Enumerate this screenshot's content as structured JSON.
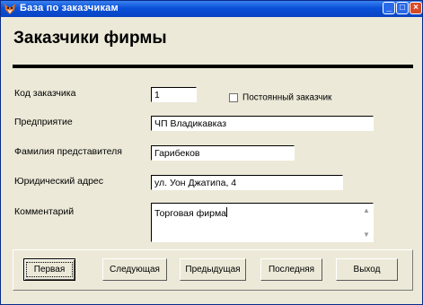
{
  "window": {
    "title": "База по заказчикам",
    "app_icon": "fox-icon",
    "controls": {
      "minimize": "_",
      "maximize": "□",
      "close": "×"
    }
  },
  "form": {
    "heading": "Заказчики фирмы",
    "fields": {
      "customer_code": {
        "label": "Код заказчика",
        "value": "1"
      },
      "regular_customer": {
        "label": "Постоянный заказчик",
        "checked": false
      },
      "company": {
        "label": "Предприятие",
        "value": "ЧП Владикавказ"
      },
      "representative": {
        "label": "Фамилия представителя",
        "value": "Гарибеков"
      },
      "legal_address": {
        "label": "Юридический адрес",
        "value": "ул. Уон Джатипа, 4"
      },
      "comment": {
        "label": "Комментарий",
        "value": "Торговая фирма"
      }
    }
  },
  "buttons": {
    "first": "Первая",
    "next": "Следующая",
    "previous": "Предыдущая",
    "last": "Последняя",
    "exit": "Выход"
  }
}
